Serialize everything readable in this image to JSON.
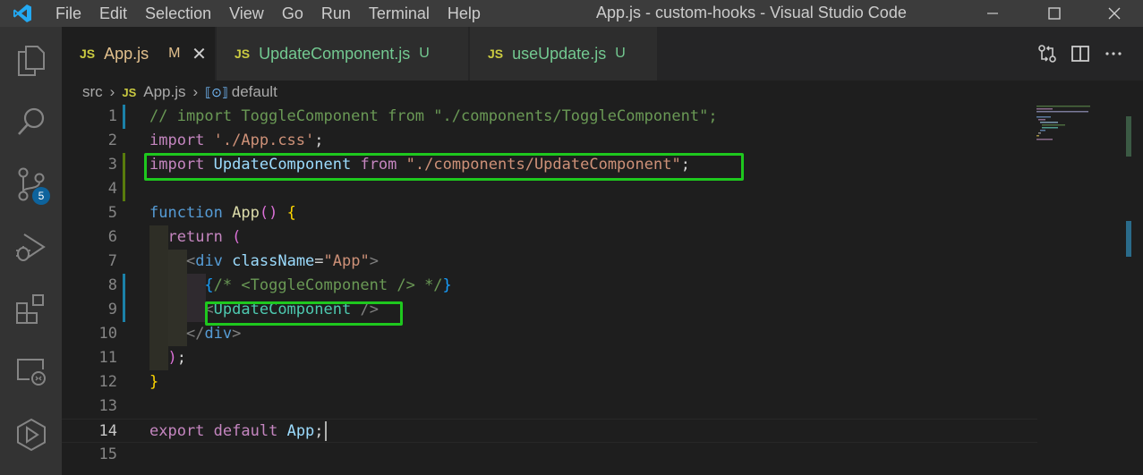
{
  "window": {
    "title": "App.js - custom-hooks - Visual Studio Code",
    "menu": [
      "File",
      "Edit",
      "Selection",
      "View",
      "Go",
      "Run",
      "Terminal",
      "Help"
    ]
  },
  "activity_bar": {
    "icons": [
      "explorer-icon",
      "search-icon",
      "source-control-icon",
      "run-debug-icon",
      "extensions-icon",
      "remote-explorer-icon",
      "live-share-icon"
    ],
    "source_control_badge": "5"
  },
  "tabs": [
    {
      "lang": "JS",
      "name": "App.js",
      "status": "M",
      "active": true
    },
    {
      "lang": "JS",
      "name": "UpdateComponent.js",
      "status": "U",
      "active": false
    },
    {
      "lang": "JS",
      "name": "useUpdate.js",
      "status": "U",
      "active": false
    }
  ],
  "breadcrumb": {
    "folder": "src",
    "file_lang": "JS",
    "file": "App.js",
    "symbol": "default"
  },
  "editor": {
    "current_line": "14",
    "line_numbers": [
      "1",
      "2",
      "3",
      "4",
      "5",
      "6",
      "7",
      "8",
      "9",
      "10",
      "11",
      "12",
      "13",
      "14",
      "15"
    ],
    "lines": [
      "// import ToggleComponent from \"./components/ToggleComponent\";",
      "import './App.css';",
      "import UpdateComponent from \"./components/UpdateComponent\";",
      "",
      "function App() {",
      "  return (",
      "    <div className=\"App\">",
      "      {/* <ToggleComponent /> */}",
      "      <UpdateComponent />",
      "    </div>",
      "  );",
      "}",
      "",
      "export default App;",
      ""
    ]
  },
  "colors": {
    "highlight_box": "#1ec81e",
    "badge": "#0e639c",
    "modified_tab": "#e2c08d",
    "untracked_tab": "#73c991"
  }
}
